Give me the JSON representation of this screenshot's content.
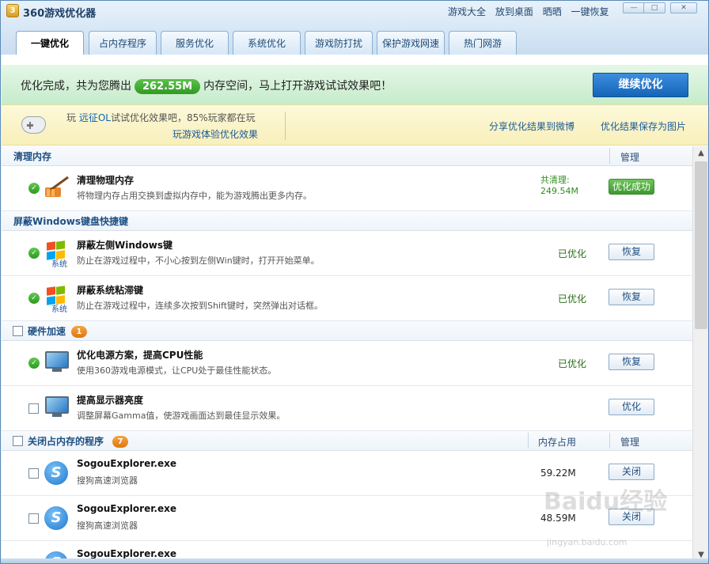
{
  "app": {
    "title": "360游戏优化器",
    "links": [
      "游戏大全",
      "放到桌面",
      "晒晒",
      "一键恢复"
    ]
  },
  "tabs": [
    "一键优化",
    "占内存程序",
    "服务优化",
    "系统优化",
    "游戏防打扰",
    "保护游戏网速",
    "热门网游"
  ],
  "banner": {
    "prefix": "优化完成，共为您腾出",
    "amount": "262.55M",
    "suffix": "内存空间，马上打开游戏试试效果吧！",
    "continue_label": "继续优化"
  },
  "promo": {
    "play_prefix": "玩",
    "game_name": "远征OL",
    "play_suffix": "试试优化效果吧，85%玩家都在玩",
    "experience_link": "玩游戏体验优化效果",
    "share_link": "分享优化结果到微博",
    "save_link": "优化结果保存为图片"
  },
  "sections": {
    "memory": {
      "title": "清理内存",
      "manage_col": "管理",
      "row": {
        "title": "清理物理内存",
        "desc": "将物理内存占用交换到虚拟内存中，能为游戏腾出更多内存。",
        "cleared_label": "共清理:",
        "cleared_value": "249.54M",
        "button": "优化成功"
      }
    },
    "keys": {
      "title": "屏蔽Windows键盘快捷键",
      "rows": [
        {
          "title": "屏蔽左侧Windows键",
          "desc": "防止在游戏过程中，不小心按到左侧Win键时，打开开始菜单。",
          "status": "已优化",
          "button": "恢复"
        },
        {
          "title": "屏蔽系统粘滞键",
          "desc": "防止在游戏过程中，连续多次按到Shift键时，突然弹出对话框。",
          "status": "已优化",
          "button": "恢复"
        }
      ],
      "sys_label": "系统"
    },
    "hardware": {
      "title": "硬件加速",
      "badge": "1",
      "rows": [
        {
          "title": "优化电源方案，提高CPU性能",
          "desc": "使用360游戏电源模式，让CPU处于最佳性能状态。",
          "status": "已优化",
          "button": "恢复"
        },
        {
          "title": "提高显示器亮度",
          "desc": "调整屏幕Gamma值，使游戏画面达到最佳显示效果。",
          "status": "",
          "button": "优化"
        }
      ]
    },
    "programs": {
      "title": "关闭占内存的程序",
      "badge": "7",
      "mem_col": "内存占用",
      "manage_col": "管理",
      "rows": [
        {
          "title": "SogouExplorer.exe",
          "desc": "搜狗高速浏览器",
          "size": "59.22M",
          "button": "关闭"
        },
        {
          "title": "SogouExplorer.exe",
          "desc": "搜狗高速浏览器",
          "size": "48.59M",
          "button": "关闭"
        },
        {
          "title": "SogouExplorer.exe",
          "desc": "",
          "size": "",
          "button": ""
        }
      ]
    }
  },
  "watermark": {
    "brand": "Baidu经验",
    "site": "jingyan.baidu.com"
  },
  "colors": {
    "accent": "#1465b8",
    "success": "#3c9a2c",
    "badge": "#df7610",
    "promo_bg": "#fdf9d9"
  }
}
